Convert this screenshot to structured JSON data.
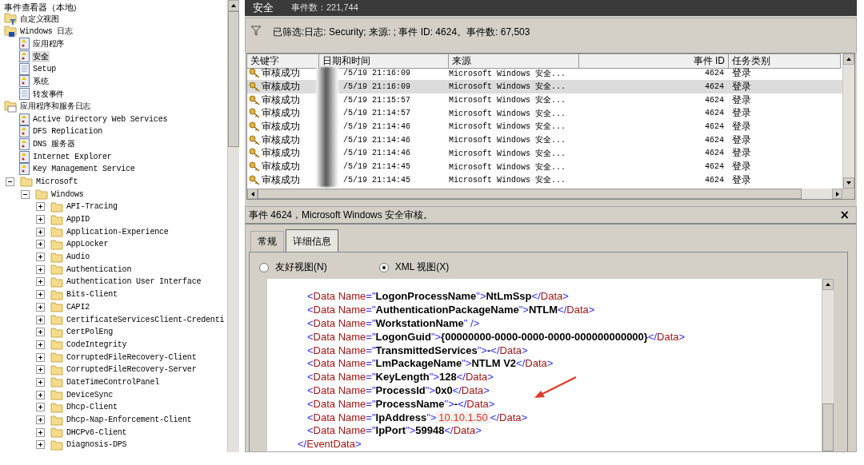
{
  "tree": {
    "root_label": "事件查看器（本地）",
    "items": [
      {
        "label": "自定义视图",
        "kind": "filter_folder",
        "selected": false
      },
      {
        "label": "Windows 日志",
        "kind": "windows_folder",
        "selected": false,
        "children": [
          {
            "label": "应用程序",
            "kind": "log",
            "selected": false
          },
          {
            "label": "安全",
            "kind": "log",
            "selected": true
          },
          {
            "label": "Setup",
            "kind": "plain_log",
            "selected": false
          },
          {
            "label": "系统",
            "kind": "log",
            "selected": false
          },
          {
            "label": "转发事件",
            "kind": "plain_log",
            "selected": false
          }
        ]
      },
      {
        "label": "应用程序和服务日志",
        "kind": "logs_folder",
        "selected": false,
        "children": [
          {
            "label": "Active Directory Web Services",
            "kind": "log",
            "selected": false
          },
          {
            "label": "DFS Replication",
            "kind": "log",
            "selected": false
          },
          {
            "label": "DNS 服务器",
            "kind": "log",
            "selected": false
          },
          {
            "label": "Internet Explorer",
            "kind": "log",
            "selected": false
          },
          {
            "label": "Key Management Service",
            "kind": "log",
            "selected": false
          },
          {
            "label": "Microsoft",
            "kind": "folder",
            "selected": false,
            "expanded": true,
            "children": [
              {
                "label": "Windows",
                "kind": "folder",
                "selected": false,
                "expanded": true,
                "children": [
                  {
                    "label": "API-Tracing",
                    "kind": "folder",
                    "selected": false,
                    "expanded": false
                  },
                  {
                    "label": "AppID",
                    "kind": "folder",
                    "selected": false,
                    "expanded": false
                  },
                  {
                    "label": "Application-Experience",
                    "kind": "folder",
                    "selected": false,
                    "expanded": false
                  },
                  {
                    "label": "AppLocker",
                    "kind": "folder",
                    "selected": false,
                    "expanded": false
                  },
                  {
                    "label": "Audio",
                    "kind": "folder",
                    "selected": false,
                    "expanded": false
                  },
                  {
                    "label": "Authentication",
                    "kind": "folder",
                    "selected": false,
                    "expanded": false
                  },
                  {
                    "label": "Authentication User Interface",
                    "kind": "folder",
                    "selected": false,
                    "expanded": false
                  },
                  {
                    "label": "Bits-Client",
                    "kind": "folder",
                    "selected": false,
                    "expanded": false
                  },
                  {
                    "label": "CAPI2",
                    "kind": "folder",
                    "selected": false,
                    "expanded": false
                  },
                  {
                    "label": "CertificateServicesClient-Credenti",
                    "kind": "folder",
                    "selected": false,
                    "expanded": false
                  },
                  {
                    "label": "CertPolEng",
                    "kind": "folder",
                    "selected": false,
                    "expanded": false
                  },
                  {
                    "label": "CodeIntegrity",
                    "kind": "folder",
                    "selected": false,
                    "expanded": false
                  },
                  {
                    "label": "CorruptedFileRecovery-Client",
                    "kind": "folder",
                    "selected": false,
                    "expanded": false
                  },
                  {
                    "label": "CorruptedFileRecovery-Server",
                    "kind": "folder",
                    "selected": false,
                    "expanded": false
                  },
                  {
                    "label": "DateTimeControlPanel",
                    "kind": "folder",
                    "selected": false,
                    "expanded": false
                  },
                  {
                    "label": "DeviceSync",
                    "kind": "folder",
                    "selected": false,
                    "expanded": false
                  },
                  {
                    "label": "Dhcp-Client",
                    "kind": "folder",
                    "selected": false,
                    "expanded": false
                  },
                  {
                    "label": "Dhcp-Nap-Enforcement-Client",
                    "kind": "folder",
                    "selected": false,
                    "expanded": false
                  },
                  {
                    "label": "DHCPv6-Client",
                    "kind": "folder",
                    "selected": false,
                    "expanded": false
                  },
                  {
                    "label": "Diagnosis-DPS",
                    "kind": "folder",
                    "selected": false,
                    "expanded": false
                  }
                ]
              }
            ]
          }
        ]
      }
    ]
  },
  "log_header": {
    "title": "安全",
    "count": "事件数：221,744"
  },
  "filter": {
    "text": "已筛选:日志: Security; 来源: ; 事件 ID: 4624。事件数: 67,503"
  },
  "table": {
    "columns": [
      "关键字",
      "日期和时间",
      "来源",
      "事件 ID",
      "任务类别"
    ],
    "rows": [
      {
        "keyword": "审核成功",
        "datetime": "/5/19 21:16:09",
        "source": "Microsoft Windows 安全...",
        "event_id": "4624",
        "task": "登录",
        "selected": false
      },
      {
        "keyword": "审核成功",
        "datetime": "/5/19 21:16:09",
        "source": "Microsoft Windows 安全...",
        "event_id": "4624",
        "task": "登录",
        "selected": true
      },
      {
        "keyword": "审核成功",
        "datetime": "/5/19 21:15:57",
        "source": "Microsoft Windows 安全...",
        "event_id": "4624",
        "task": "登录",
        "selected": false
      },
      {
        "keyword": "审核成功",
        "datetime": "/5/19 21:14:57",
        "source": "Microsoft Windows 安全...",
        "event_id": "4624",
        "task": "登录",
        "selected": false
      },
      {
        "keyword": "审核成功",
        "datetime": "/5/19 21:14:46",
        "source": "Microsoft Windows 安全...",
        "event_id": "4624",
        "task": "登录",
        "selected": false
      },
      {
        "keyword": "审核成功",
        "datetime": "/5/19 21:14:46",
        "source": "Microsoft Windows 安全...",
        "event_id": "4624",
        "task": "登录",
        "selected": false
      },
      {
        "keyword": "审核成功",
        "datetime": "/5/19 21:14:46",
        "source": "Microsoft Windows 安全...",
        "event_id": "4624",
        "task": "登录",
        "selected": false
      },
      {
        "keyword": "审核成功",
        "datetime": "/5/19 21:14:45",
        "source": "Microsoft Windows 安全...",
        "event_id": "4624",
        "task": "登录",
        "selected": false
      },
      {
        "keyword": "审核成功",
        "datetime": "/5/19 21:14:45",
        "source": "Microsoft Windows 安全...",
        "event_id": "4624",
        "task": "登录",
        "selected": false
      }
    ]
  },
  "detail": {
    "title": "事件 4624，Microsoft Windows 安全审核。",
    "close": "×",
    "tabs": [
      {
        "label": "常规",
        "selected": false
      },
      {
        "label": "详细信息",
        "selected": true
      }
    ],
    "views": [
      {
        "label": "友好视图(N)",
        "selected": false
      },
      {
        "label": "XML 视图(X)",
        "selected": true
      }
    ],
    "xml_lines": [
      {
        "kind": "data",
        "open": "<Data Name=\"LogonProcessName\">",
        "value": "NtLmSsp",
        "close": "</Data>"
      },
      {
        "kind": "data",
        "open": "<Data Name=\"AuthenticationPackageName\">",
        "value": "NTLM",
        "close": "</Data>"
      },
      {
        "kind": "data",
        "open": "<Data Name=\"WorkstationName\" />"
      },
      {
        "kind": "data",
        "open": "<Data Name=\"LogonGuid\">",
        "value": "{00000000-0000-0000-0000-000000000000}",
        "close": "</Data>"
      },
      {
        "kind": "data",
        "open": "<Data Name=\"TransmittedServices\">",
        "value": "-",
        "close": "</Data>"
      },
      {
        "kind": "data",
        "open": "<Data Name=\"LmPackageName\">",
        "value": "NTLM V2",
        "close": "</Data>"
      },
      {
        "kind": "data",
        "open": "<Data Name=\"KeyLength\">",
        "value": "128",
        "close": "</Data>"
      },
      {
        "kind": "data",
        "open": "<Data Name=\"ProcessId\">",
        "value": "0x0",
        "close": "</Data>"
      },
      {
        "kind": "data",
        "open": "<Data Name=\"ProcessName\">",
        "value": "-",
        "close": "</Data>"
      },
      {
        "kind": "data",
        "open": "<Data Name=\"IpAddress\">",
        "value": "10.10.1.50",
        "close": "</Data>",
        "highlighted": true
      },
      {
        "kind": "data",
        "open": "<Data Name=\"IpPort\">",
        "value": "59948",
        "close": "</Data>"
      },
      {
        "kind": "section_end",
        "open": "</EventData>"
      }
    ]
  }
}
